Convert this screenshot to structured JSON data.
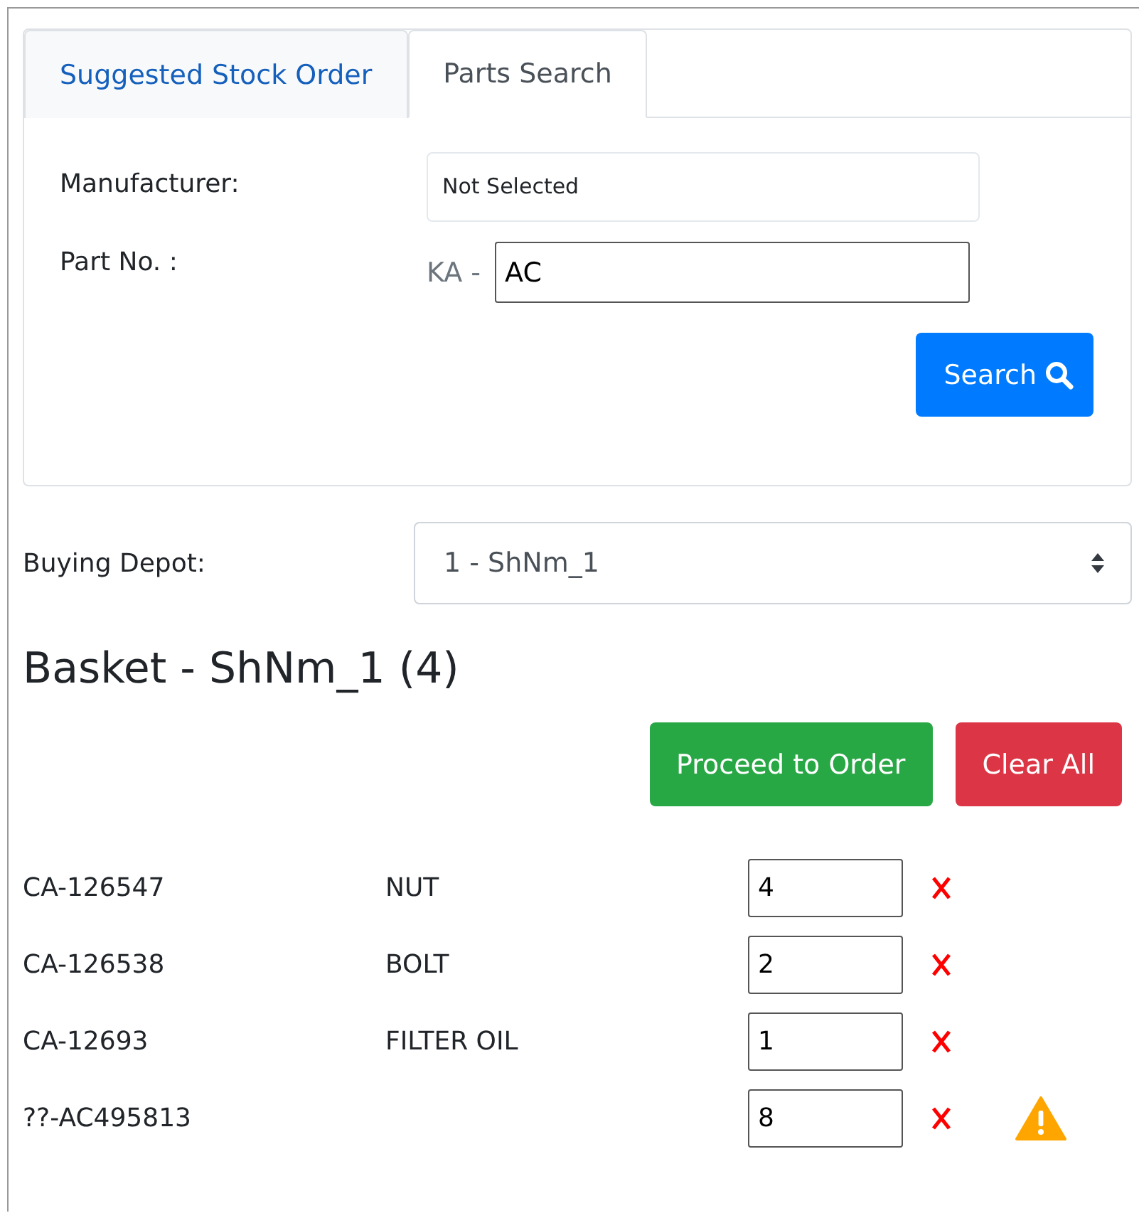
{
  "tabs": [
    {
      "label": "Suggested Stock Order",
      "selected": false
    },
    {
      "label": "Parts Search",
      "selected": true
    }
  ],
  "search_form": {
    "manufacturer_label": "Manufacturer:",
    "manufacturer_value": "Not Selected",
    "part_no_label": "Part No. :",
    "part_no_prefix": "KA -",
    "part_no_value": "AC",
    "search_button": "Search"
  },
  "buying_depot": {
    "label": "Buying Depot:",
    "value": "1 - ShNm_1"
  },
  "basket": {
    "title": "Basket - ShNm_1 (4)",
    "proceed_button": "Proceed to Order",
    "clear_button": "Clear All",
    "items": [
      {
        "part_no": "CA-126547",
        "description": "NUT",
        "quantity": "4",
        "warning": false
      },
      {
        "part_no": "CA-126538",
        "description": "BOLT",
        "quantity": "2",
        "warning": false
      },
      {
        "part_no": "CA-12693",
        "description": "FILTER OIL",
        "quantity": "1",
        "warning": false
      },
      {
        "part_no": "??-AC495813",
        "quantity": "8",
        "warning": true
      }
    ]
  }
}
